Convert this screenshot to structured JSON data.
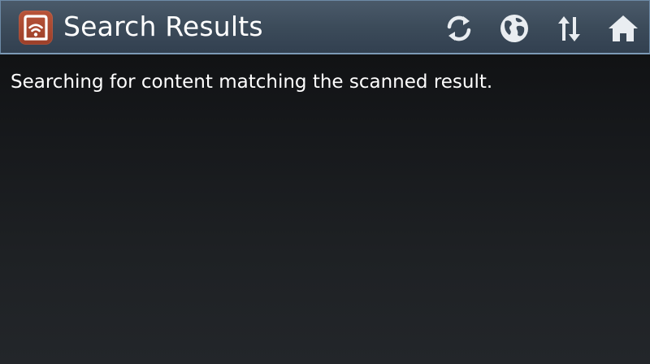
{
  "action_bar": {
    "title": "Search Results",
    "app_icon": "wifi-card-icon",
    "actions": [
      {
        "name": "refresh",
        "icon": "refresh-icon"
      },
      {
        "name": "globe",
        "icon": "globe-icon"
      },
      {
        "name": "sort",
        "icon": "up-down-arrows-icon"
      },
      {
        "name": "home",
        "icon": "home-icon"
      }
    ]
  },
  "content": {
    "message": "Searching for content matching the scanned result."
  },
  "colors": {
    "action_bar": "#3c4b5a",
    "app_icon_bg": "#a9482f",
    "text": "#ffffff"
  }
}
